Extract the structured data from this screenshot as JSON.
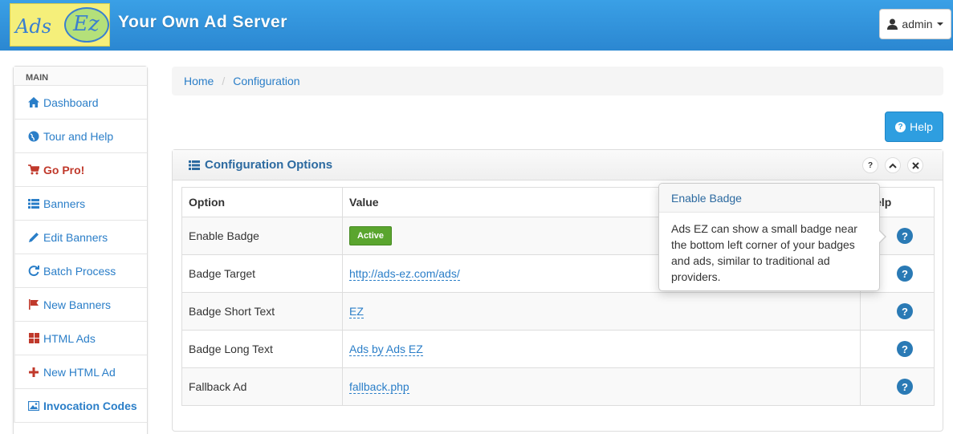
{
  "header": {
    "logo_text_a": "Ads",
    "logo_text_b": "Ez",
    "brand": "Your Own Ad Server",
    "user_label": "admin",
    "user_icon": "user-icon"
  },
  "sidebar": {
    "heading": "MAIN",
    "items": [
      {
        "label": "Dashboard",
        "icon": "home-icon"
      },
      {
        "label": "Tour and Help",
        "icon": "globe-icon"
      },
      {
        "label": "Go Pro!",
        "icon": "cart-icon"
      },
      {
        "label": "Banners",
        "icon": "list-icon"
      },
      {
        "label": "Edit Banners",
        "icon": "pencil-icon"
      },
      {
        "label": "Batch Process",
        "icon": "refresh-icon"
      },
      {
        "label": "New Banners",
        "icon": "flag-icon"
      },
      {
        "label": "HTML Ads",
        "icon": "grid-icon"
      },
      {
        "label": "New HTML Ad",
        "icon": "plus-icon"
      },
      {
        "label": "Invocation Codes",
        "icon": "picture-icon"
      }
    ]
  },
  "breadcrumb": {
    "home": "Home",
    "current": "Configuration",
    "separator": "/"
  },
  "help_button": {
    "label": "Help"
  },
  "panel": {
    "title": "Configuration Options",
    "columns": {
      "option": "Option",
      "value": "Value",
      "help": "Help"
    },
    "rows": [
      {
        "option": "Enable Badge",
        "value": "Active",
        "type": "badge"
      },
      {
        "option": "Badge Target",
        "value": "http://ads-ez.com/ads/",
        "type": "link"
      },
      {
        "option": "Badge Short Text",
        "value": "EZ",
        "type": "link"
      },
      {
        "option": "Badge Long Text",
        "value": "Ads by Ads EZ",
        "type": "link"
      },
      {
        "option": "Fallback Ad",
        "value": "fallback.php",
        "type": "link"
      }
    ]
  },
  "popover": {
    "title": "Enable Badge",
    "body": "Ads EZ can show a small badge near the bottom left corner of your badges and ads, similar to traditional ad providers."
  },
  "colors": {
    "topbar": "#2b87d1",
    "link": "#2a7ec8",
    "active_badge": "#5aa52e",
    "gopro": "#c0392b"
  }
}
